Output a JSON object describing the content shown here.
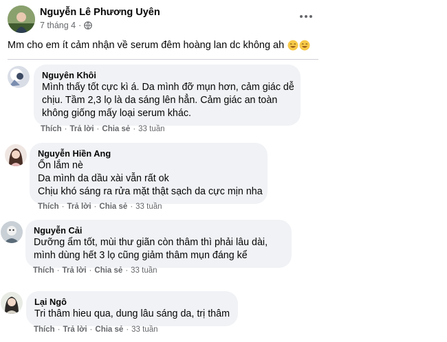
{
  "post": {
    "author": "Nguyễn Lê Phương Uyên",
    "date": "7 tháng 4",
    "dot": "·",
    "text": "Mm cho em ít cảm nhận về serum đêm hoàng lan dc không ah"
  },
  "actions": {
    "like": "Thích",
    "reply": "Trả lời",
    "share": "Chia sẻ",
    "sep": "·"
  },
  "comments": [
    {
      "name": "Nguyên Khôi",
      "lines": [
        "Mình thấy tốt cực kì á. Da mình đỡ mụn hơn, cảm giác dễ",
        "chịu. Tầm 2,3 lọ là da sáng lên hẳn. Cảm giác an toàn",
        "không giống mấy loại serum khác."
      ],
      "time": "33 tuần"
    },
    {
      "name": "Nguyễn Hiền Ang",
      "lines": [
        "Ổn lắm nè",
        "Da mình da dầu xài vẫn rất ok",
        "Chịu khó sáng ra rửa mặt thật sạch da cực mịn nha"
      ],
      "time": "33 tuần"
    },
    {
      "name": "Nguyễn Cải",
      "lines": [
        "Dưỡng ẩm tốt, mùi thư giãn còn thâm thì phải lâu dài,",
        "mình dùng hết 3 lọ cũng giảm thâm mụn đáng kể"
      ],
      "time": "33 tuần"
    },
    {
      "name": "Lại Ngô",
      "lines": [
        "Tri thâm hieu qua, dung lâu sáng da, trị thâm"
      ],
      "time": "33 tuần"
    }
  ],
  "icons": {
    "globe": "globe-icon",
    "more": "more-options-icon",
    "emoji": "smiling-face-icon"
  },
  "colors": {
    "bubble": "#f0f2f5",
    "secondary_text": "#65676b",
    "primary_text": "#050505"
  }
}
